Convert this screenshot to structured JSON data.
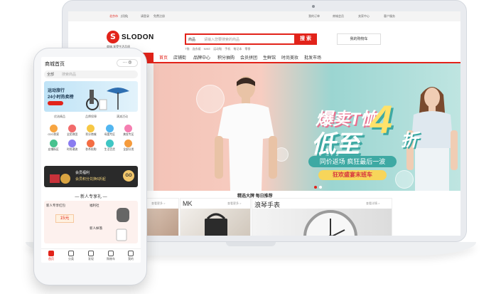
{
  "desktop": {
    "topbar": {
      "city": "北京市",
      "login": "[切换]",
      "links": [
        "请登录",
        "免费注册"
      ],
      "right": [
        "我的订单",
        "商城会员",
        "卖家中心",
        "客户服务"
      ]
    },
    "logo": {
      "mark": "S",
      "name": "SLODON",
      "tagline": "商城,享受生活品质"
    },
    "search": {
      "category": "商品",
      "placeholder": "请输入您要搜索的商品",
      "button": "搜 索"
    },
    "hot": "T恤 连衣裙 NIKE 运动鞋 手机 笔记本 零食",
    "cart": "我的购物车",
    "nav": [
      "首页",
      "店铺街",
      "品牌中心",
      "积分抽购",
      "会员拼团",
      "生鲜馆",
      "时尚美妆",
      "批发市场"
    ],
    "banner": {
      "title1": "爆卖T恤",
      "title2": "低至",
      "number": "4",
      "suffix": "折",
      "pill": "同价返场 疯狂最后一波",
      "pill2": "狂欢盛宴末班车"
    },
    "recommend": "精选大牌 每日推荐",
    "cards": [
      {
        "title": "",
        "more": "查看更多 >"
      },
      {
        "title": "MK",
        "more": "查看更多 >"
      },
      {
        "title": "浪琴手表",
        "more": "查看详情 >"
      }
    ]
  },
  "mobile": {
    "title": "商城首页",
    "search": {
      "scope": "全部",
      "placeholder": "搜索商品"
    },
    "hero": {
      "line1": "运动旅行",
      "line2": "24小时热卖榜"
    },
    "promos": [
      "优选精品",
      "品牌保障",
      "满减活动"
    ],
    "grid": [
      "O2O到家",
      "全民拼团",
      "积分商城",
      "母婴专区",
      "美妆专区",
      "店铺街区",
      "时尚潮流",
      "秒杀抢购",
      "生活百货",
      "全部分类"
    ],
    "member": {
      "title": "会员福利",
      "desc": "会员积分兑换6折起",
      "go": "GO"
    },
    "newcomer": "— 新人专享礼 —",
    "newbox": {
      "left": "新人专享红包",
      "coupon": "15元",
      "right_top": "福利社",
      "right_bottom": "新人掉落"
    },
    "tabs": [
      "首页",
      "分类",
      "发现",
      "购物车",
      "我的"
    ]
  }
}
